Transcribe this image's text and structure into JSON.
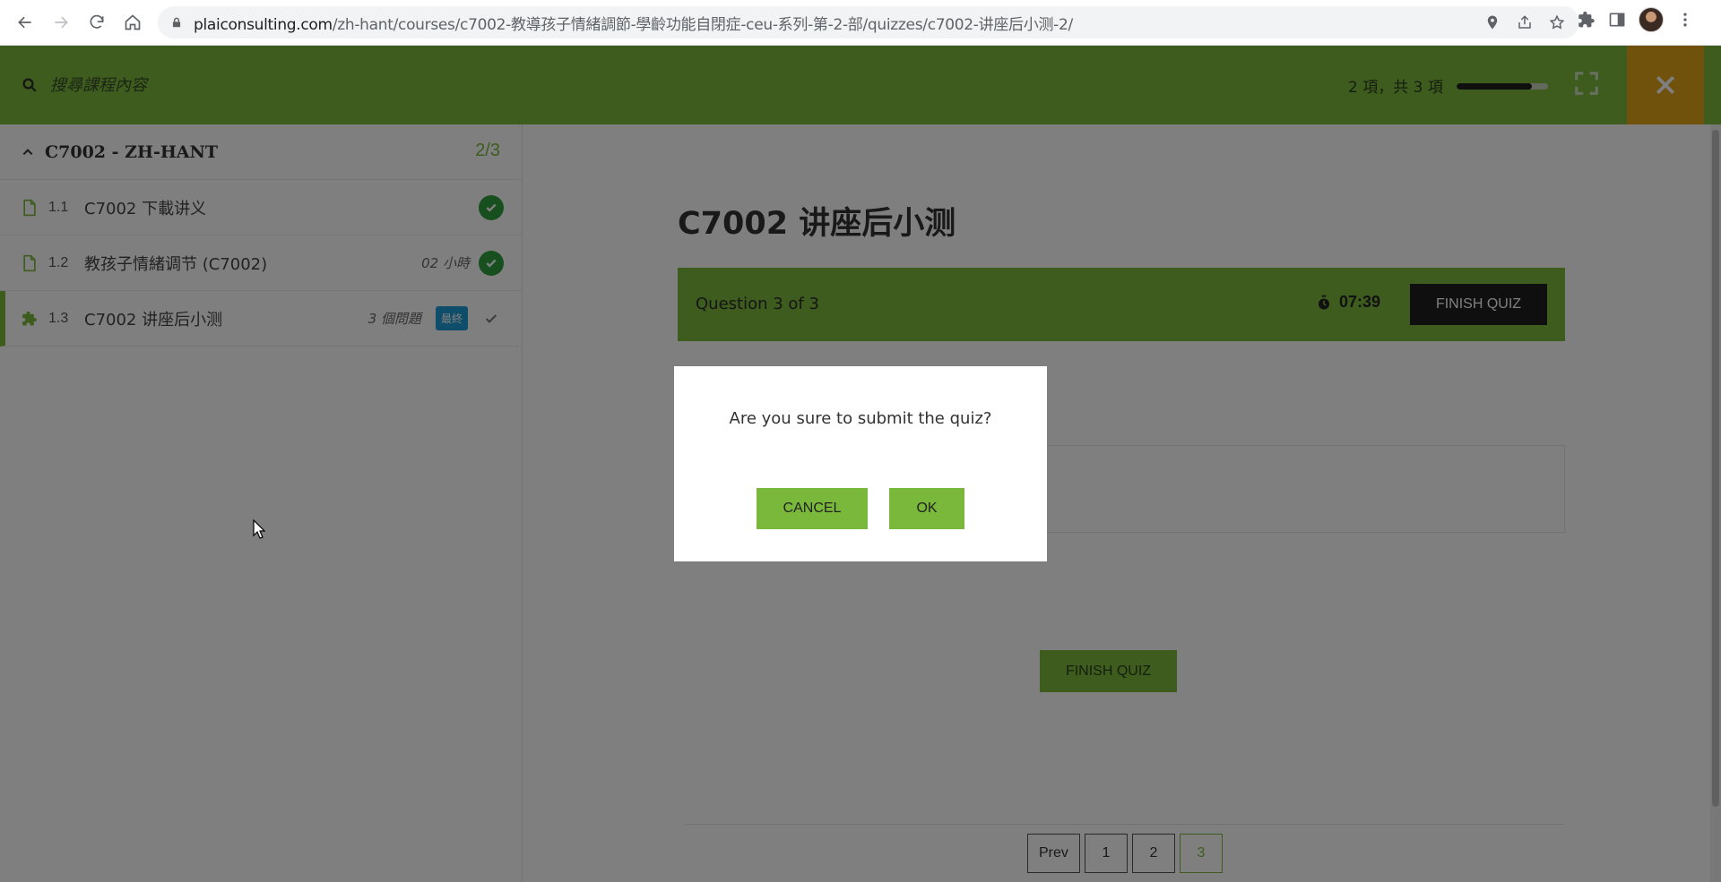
{
  "browser": {
    "url_host": "plaiconsulting.com",
    "url_path": "/zh-hant/courses/c7002-教導孩子情緒調節-學齡功能自閉症-ceu-系列-第-2-部/quizzes/c7002-讲座后小测-2/",
    "icons": [
      "back-icon",
      "forward-icon",
      "reload-icon",
      "home-icon",
      "lock-icon",
      "location-icon",
      "share-icon",
      "star-icon",
      "extensions-icon",
      "sidepanel-icon",
      "profile-avatar",
      "menu-icon"
    ]
  },
  "header": {
    "search_placeholder": "搜尋課程內容",
    "progress_text": "2 項，共 3 項",
    "progress_fraction": 0.82,
    "colors": {
      "header_bg": "#7ab83c",
      "close_bg": "#e2a51b"
    }
  },
  "sidebar": {
    "section": {
      "title": "C7002 - ZH-HANT",
      "count": "2/3"
    },
    "items": [
      {
        "num": "1.1",
        "label": "C7002 下載讲义",
        "meta": "",
        "badge": "",
        "status": "completed"
      },
      {
        "num": "1.2",
        "label": "教孩子情緒调节 (C7002)",
        "meta": "02 小時",
        "badge": "",
        "status": "completed"
      },
      {
        "num": "1.3",
        "label": "C7002 讲座后小测",
        "meta": "3 個問題",
        "badge": "最終",
        "status": "current"
      }
    ]
  },
  "quiz": {
    "title": "C7002 讲座后小测",
    "counter": "Question 3 of 3",
    "timer": "07:39",
    "finish_label": "FINISH QUIZ",
    "finish_bottom_label": "FINISH QUIZ",
    "pager": {
      "prev": "Prev",
      "pages": [
        "1",
        "2",
        "3"
      ],
      "current": "3"
    }
  },
  "modal": {
    "message": "Are you sure to submit the quiz?",
    "cancel_label": "CANCEL",
    "ok_label": "OK"
  }
}
